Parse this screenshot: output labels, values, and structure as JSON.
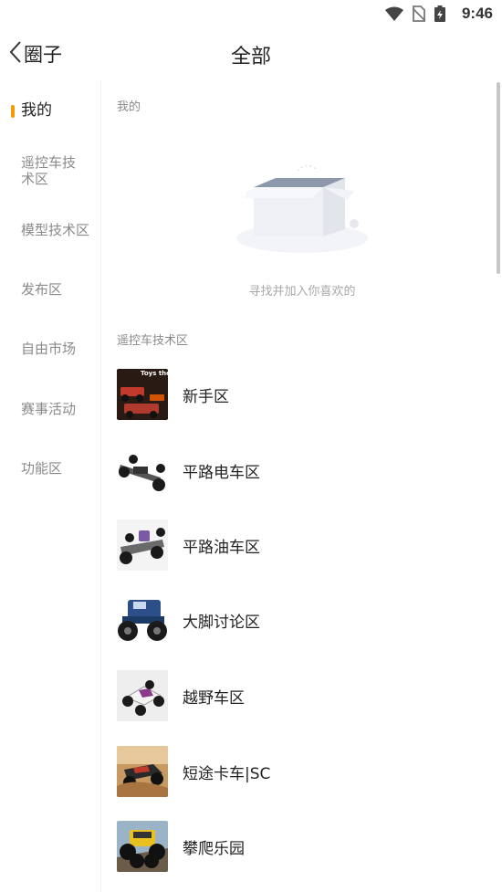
{
  "status": {
    "time": "9:46"
  },
  "header": {
    "back_label": "圈子",
    "title": "全部"
  },
  "sidebar": {
    "items": [
      {
        "label": "我的",
        "active": true
      },
      {
        "label": "遥控车技术区",
        "active": false
      },
      {
        "label": "模型技术区",
        "active": false
      },
      {
        "label": "发布区",
        "active": false
      },
      {
        "label": "自由市场",
        "active": false
      },
      {
        "label": "赛事活动",
        "active": false
      },
      {
        "label": "功能区",
        "active": false
      }
    ]
  },
  "main": {
    "mine_section": {
      "label": "我的",
      "empty_text": "寻找并加入你喜欢的"
    },
    "rc_section": {
      "label": "遥控车技术区",
      "items": [
        {
          "name": "新手区",
          "thumb_text": "Toys they're not"
        },
        {
          "name": "平路电车区"
        },
        {
          "name": "平路油车区"
        },
        {
          "name": "大脚讨论区"
        },
        {
          "name": "越野车区"
        },
        {
          "name": "短途卡车|SC"
        },
        {
          "name": "攀爬乐园"
        }
      ]
    }
  },
  "colors": {
    "accent": "#f39a00",
    "muted_text": "#8a8a8a"
  }
}
